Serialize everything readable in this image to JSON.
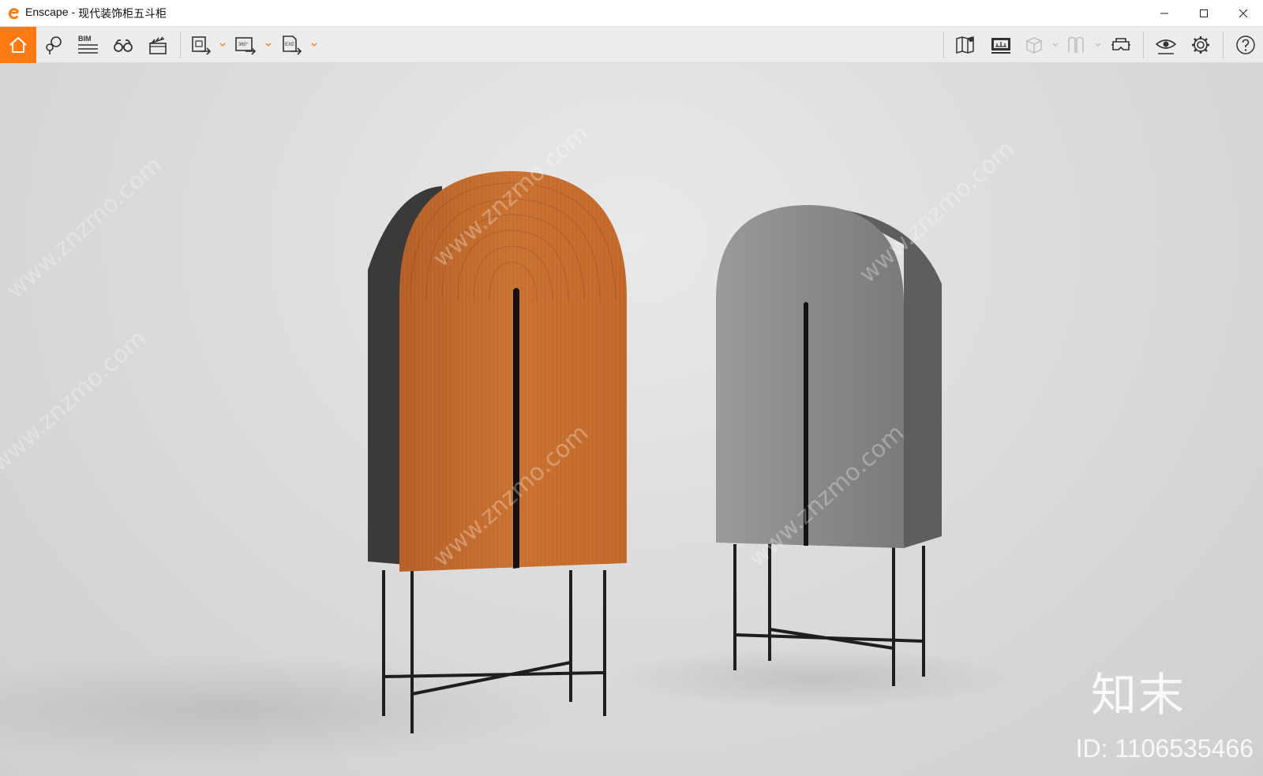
{
  "window": {
    "app_name": "Enscape",
    "separator": "-",
    "document_title": "现代装饰柜五斗柜",
    "controls": [
      "minimize-icon",
      "maximize-icon",
      "close-icon"
    ]
  },
  "toolbar": {
    "accent_color": "#ff7b11",
    "left_items": [
      {
        "name": "home-icon",
        "active": true
      },
      {
        "name": "asset-library-icon"
      },
      {
        "name": "bim-icon",
        "label": "BIM"
      },
      {
        "name": "binoculars-icon"
      },
      {
        "name": "clapperboard-icon"
      },
      {
        "name": "export-image-icon"
      },
      {
        "name": "export-panorama-icon",
        "label": "360°"
      },
      {
        "name": "export-standalone-icon",
        "label": "EXE"
      }
    ],
    "right_items": [
      {
        "name": "map-icon"
      },
      {
        "name": "monitor-icon"
      },
      {
        "name": "cube-view-icon"
      },
      {
        "name": "bookmark-views-icon"
      },
      {
        "name": "vr-headset-icon"
      },
      {
        "name": "visual-settings-icon"
      },
      {
        "name": "gear-icon"
      },
      {
        "name": "help-icon"
      }
    ]
  },
  "viewport": {
    "background": "#dcdcdc",
    "objects": [
      {
        "name": "orange-arched-cabinet",
        "color": "#c9702c"
      },
      {
        "name": "silver-arched-cabinet",
        "color": "#8a8a8a"
      }
    ],
    "watermark_text": "www.znzmo.com",
    "watermark_brand": "知末",
    "watermark_id": "ID: 1106535466"
  }
}
